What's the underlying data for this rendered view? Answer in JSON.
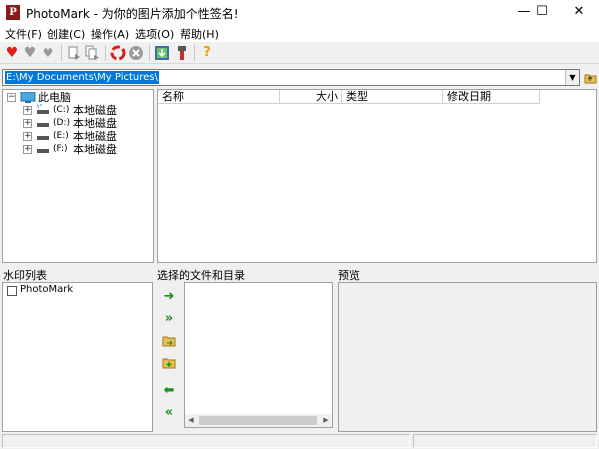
{
  "window": {
    "title": "PhotoMark - 为你的图片添加个性签名!",
    "app_icon_glyph": "P",
    "controls": {
      "minimize": "—",
      "maximize": "☐",
      "close": "✕"
    }
  },
  "menu": [
    {
      "label": "文件(F)"
    },
    {
      "label": "创建(C)"
    },
    {
      "label": "操作(A)"
    },
    {
      "label": "选项(O)"
    },
    {
      "label": "帮助(H)"
    }
  ],
  "toolbar": {
    "icons": [
      "heart-red-icon",
      "heart-gray-icon",
      "heart-gray-2-icon",
      "copy-file-icon",
      "copy-files-icon",
      "recycle-icon",
      "stop-icon",
      "image-export-icon",
      "tools-icon",
      "help-icon"
    ]
  },
  "path": {
    "value": "E:\\My Documents\\My Pictures\\"
  },
  "tree": {
    "root": "此电脑",
    "drives": [
      {
        "letter": "(C:)",
        "label": "本地磁盘"
      },
      {
        "letter": "(D:)",
        "label": "本地磁盘"
      },
      {
        "letter": "(E:)",
        "label": "本地磁盘"
      },
      {
        "letter": "(F:)",
        "label": "本地磁盘"
      }
    ]
  },
  "filelist": {
    "columns": [
      "名称",
      "大小",
      "类型",
      "修改日期"
    ]
  },
  "panes": {
    "watermark_list": "水印列表",
    "selected_files": "选择的文件和目录",
    "preview": "预览"
  },
  "watermarks": [
    {
      "label": "PhotoMark",
      "checked": false
    }
  ],
  "colors": {
    "selection": "#0078d7",
    "arrow_green": "#1a8f1a",
    "heart_red": "#e01f1f"
  }
}
